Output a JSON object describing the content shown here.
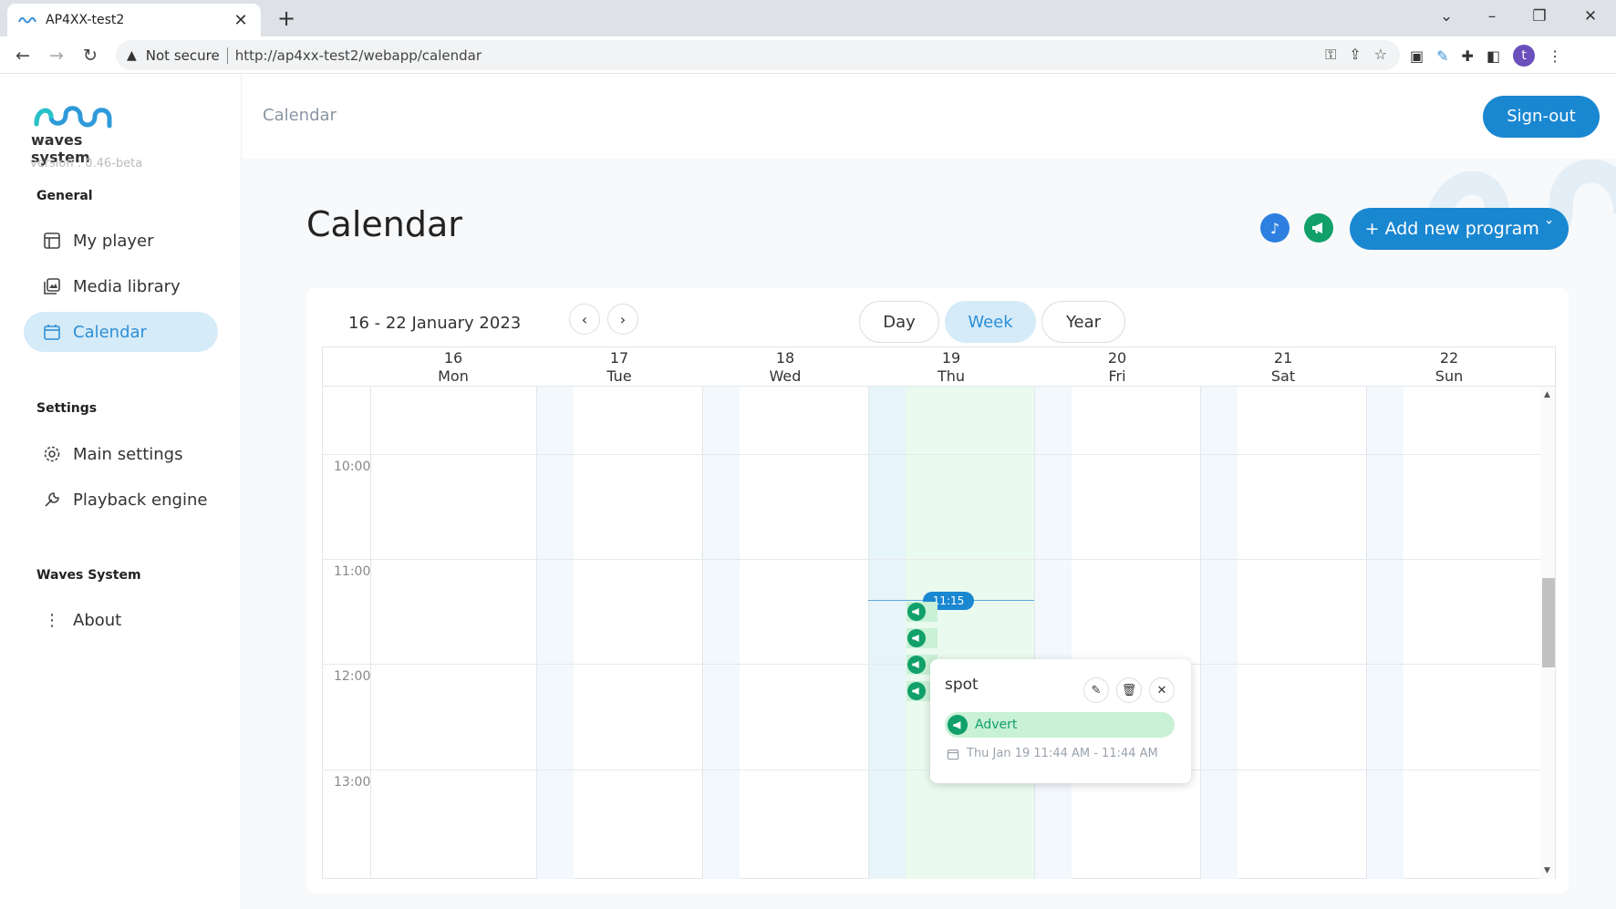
{
  "browser": {
    "tab_title": "AP4XX-test2",
    "not_secure": "Not secure",
    "url": "http://ap4xx-test2/webapp/calendar",
    "profile_initial": "t"
  },
  "sidebar": {
    "logo_text": "waves system",
    "version": "version : 0.46-beta",
    "general_heading": "General",
    "general_items": [
      {
        "label": "My player",
        "icon": "layout-icon"
      },
      {
        "label": "Media library",
        "icon": "media-library-icon"
      },
      {
        "label": "Calendar",
        "icon": "calendar-icon"
      }
    ],
    "settings_heading": "Settings",
    "settings_items": [
      {
        "label": "Main settings",
        "icon": "gear-icon"
      },
      {
        "label": "Playback engine",
        "icon": "wrench-icon"
      }
    ],
    "waves_heading": "Waves System",
    "waves_items": [
      {
        "label": "About",
        "icon": "kebab-icon"
      }
    ]
  },
  "topbar": {
    "breadcrumb": "Calendar",
    "signout": "Sign-out"
  },
  "main": {
    "title": "Calendar",
    "add_program": "+ Add new program ˇ",
    "accent": "#1a87d1",
    "advert_color": "#11a06a"
  },
  "calendar": {
    "range": "16 - 22 January 2023",
    "views": [
      "Day",
      "Week",
      "Year"
    ],
    "active_view": "Week",
    "days": [
      {
        "num": "16",
        "name": "Mon"
      },
      {
        "num": "17",
        "name": "Tue"
      },
      {
        "num": "18",
        "name": "Wed"
      },
      {
        "num": "19",
        "name": "Thu"
      },
      {
        "num": "20",
        "name": "Fri"
      },
      {
        "num": "21",
        "name": "Sat"
      },
      {
        "num": "22",
        "name": "Sun"
      }
    ],
    "times": [
      "10:00",
      "11:00",
      "12:00",
      "13:00"
    ],
    "now": "11:15"
  },
  "popup": {
    "title": "spot",
    "tag": "Advert",
    "when": "Thu Jan 19 11:44 AM - 11:44 AM"
  }
}
